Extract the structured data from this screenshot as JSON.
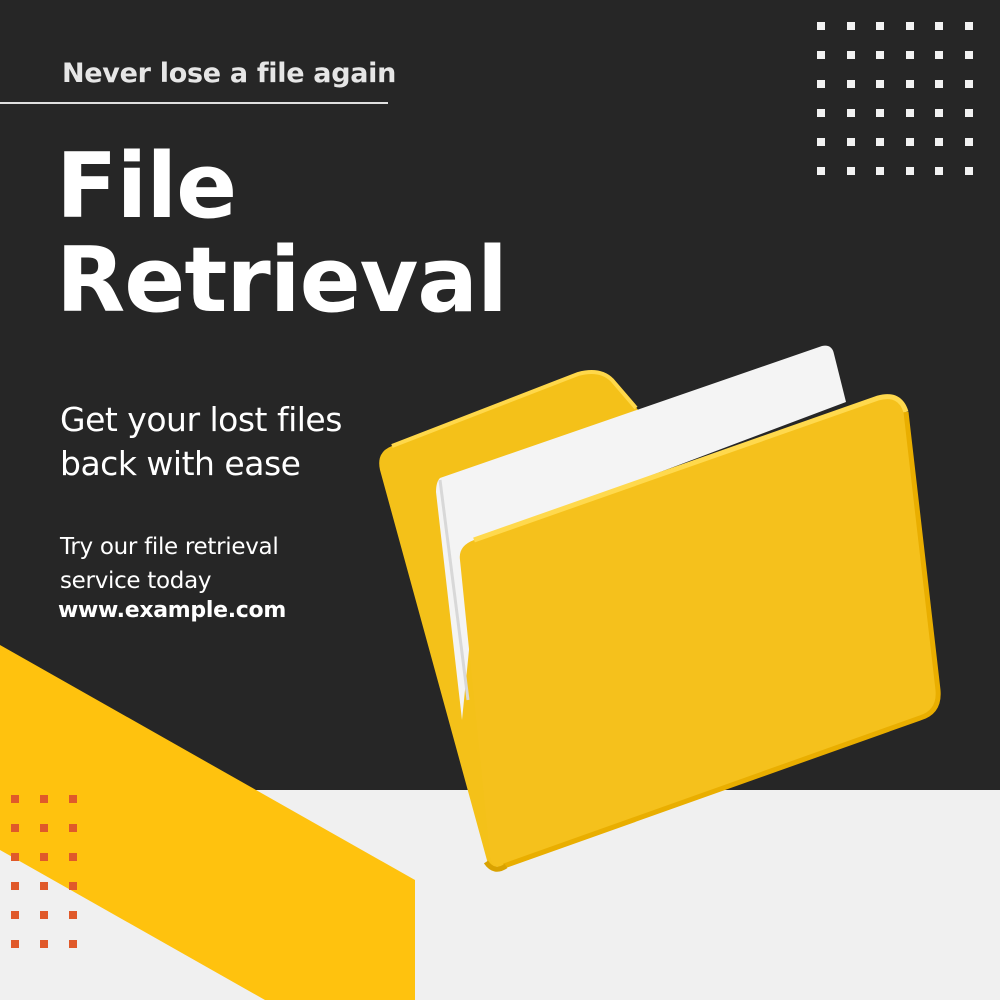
{
  "banner": {
    "tagline": "Never lose a file again",
    "title_line1": "File",
    "title_line2": "Retrieval",
    "subhead_line1": "Get your lost files",
    "subhead_line2": "back with ease",
    "body_line1": "Try our file retrieval",
    "body_line2": "service today",
    "url": "www.example.com"
  },
  "colors": {
    "dark_background": "#262626",
    "light_background": "#f0f0f0",
    "accent_yellow": "#ffc20e",
    "folder_yellow": "#f5c11c",
    "paper_white": "#f4f4f4",
    "dot_white": "#f2f2f2",
    "dot_orange": "#e0592a"
  },
  "decorations": {
    "white_dot_grid": {
      "rows": 6,
      "cols": 6,
      "icon": "square-dot-pattern"
    },
    "orange_dot_grid": {
      "rows": 6,
      "cols": 3,
      "icon": "square-dot-pattern"
    },
    "illustration": "open-folder-with-paper-icon"
  }
}
